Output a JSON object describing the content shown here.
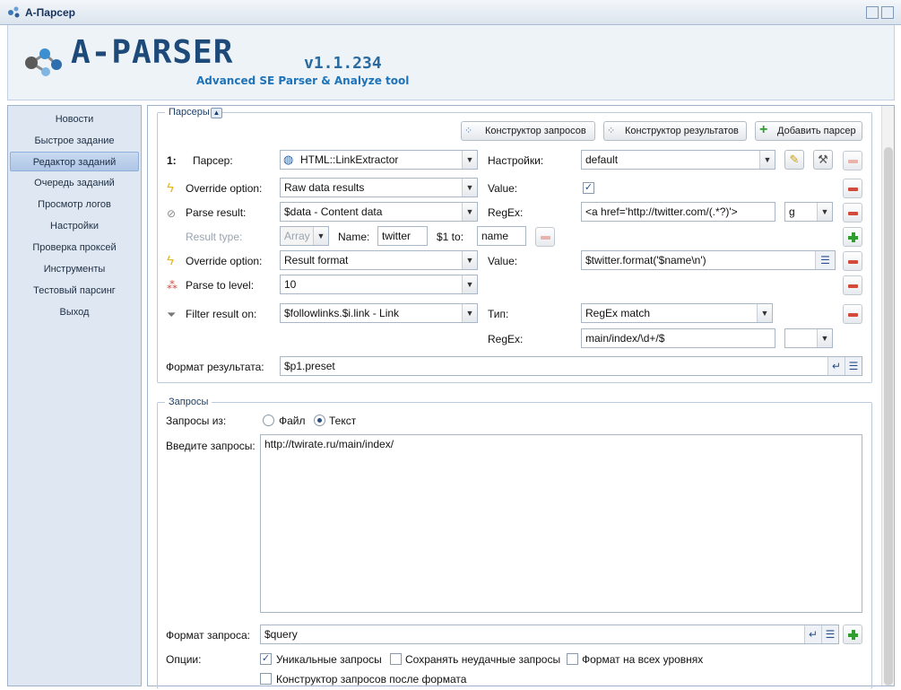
{
  "window": {
    "title": "A-Парсер"
  },
  "brand": {
    "logo_text": "A-PARSER",
    "version": "v1.1.234",
    "tagline": "Advanced SE Parser & Analyze tool"
  },
  "nav": {
    "items": [
      "Новости",
      "Быстрое задание",
      "Редактор заданий",
      "Очередь заданий",
      "Просмотр логов",
      "Настройки",
      "Проверка проксей",
      "Инструменты",
      "Тестовый парсинг",
      "Выход"
    ],
    "active_index": 2
  },
  "parsers": {
    "legend": "Парсеры",
    "buttons": {
      "query_builder": "Конструктор запросов",
      "result_builder": "Конструктор результатов",
      "add_parser": "Добавить парсер"
    },
    "row1": {
      "index": "1:",
      "label": "Парсер:",
      "value": "HTML::LinkExtractor",
      "settings_label": "Настройки:",
      "settings_value": "default"
    },
    "row2": {
      "label": "Override option:",
      "value": "Raw data results",
      "value_label": "Value:"
    },
    "row3": {
      "label": "Parse result:",
      "value": "$data - Content data",
      "regex_label": "RegEx:",
      "regex_value": "<a href='http://twitter.com/(.*?)'>",
      "flags": "g"
    },
    "row4": {
      "label": "Result type:",
      "type_value": "Array",
      "name_label": "Name:",
      "name_value": "twitter",
      "to_label": "$1 to:",
      "to_value": "name"
    },
    "row5": {
      "label": "Override option:",
      "value": "Result format",
      "value_label": "Value:",
      "value_value": "$twitter.format('$name\\n')"
    },
    "row6": {
      "label": "Parse to level:",
      "value": "10"
    },
    "row7": {
      "label": "Filter result on:",
      "value": "$followlinks.$i.link - Link",
      "type_label": "Тип:",
      "type_value": "RegEx match",
      "regex_label": "RegEx:",
      "regex_value": "main/index/\\d+/$",
      "flags": ""
    },
    "result_format": {
      "label": "Формат результата:",
      "value": "$p1.preset"
    }
  },
  "queries": {
    "legend": "Запросы",
    "from_label": "Запросы из:",
    "file_label": "Файл",
    "text_label": "Текст",
    "selected": "text",
    "enter_label": "Введите запросы:",
    "queries_text": "http://twirate.ru/main/index/",
    "format_label": "Формат запроса:",
    "format_value": "$query",
    "options_label": "Опции:",
    "options": [
      {
        "label": "Уникальные запросы",
        "checked": true
      },
      {
        "label": "Сохранять неудачные запросы",
        "checked": false
      },
      {
        "label": "Формат на всех уровнях",
        "checked": false
      },
      {
        "label": "Конструктор запросов после формата",
        "checked": false
      }
    ]
  }
}
